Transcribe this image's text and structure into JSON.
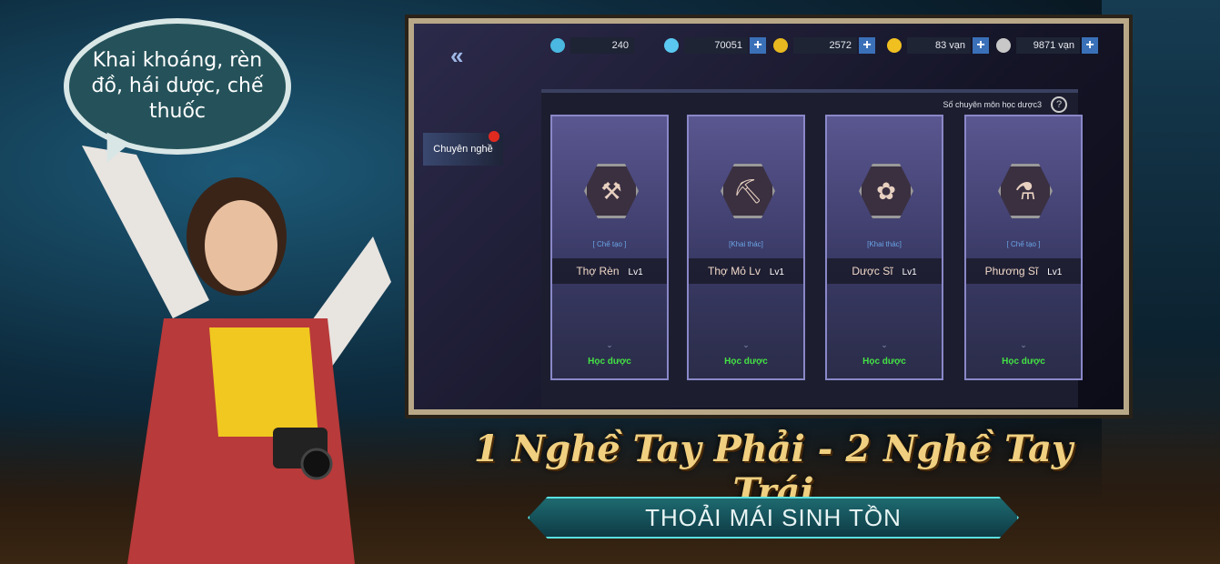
{
  "speech_bubble": "Khai khoáng, rèn đồ, hái dược, chế thuốc",
  "resources": [
    {
      "icon": "water-drop-icon",
      "value": "240",
      "color": "#4ab8e0",
      "plus": false
    },
    {
      "icon": "diamond-icon",
      "value": "70051",
      "color": "#5ac8f0",
      "plus": true
    },
    {
      "icon": "locked-gold-icon",
      "value": "2572",
      "color": "#e8b820",
      "plus": true
    },
    {
      "icon": "gold-coin-icon",
      "value": "83 vạn",
      "color": "#f0c020",
      "plus": true
    },
    {
      "icon": "silver-coin-icon",
      "value": "9871 vạn",
      "color": "#c8c8c8",
      "plus": true
    }
  ],
  "plus_label": "+",
  "back_label": "«",
  "side_tab": "Chuyên nghề",
  "count_label": "Số chuyên môn học dược3",
  "help_label": "?",
  "professions": [
    {
      "type": "[ Chế tạo ]",
      "name": "Thợ Rèn",
      "level": "Lv1",
      "icon": "hammer-icon",
      "glyph": "⚒",
      "action": "Học dược"
    },
    {
      "type": "[Khai thác]",
      "name": "Thợ Mỏ Lv",
      "level": "Lv1",
      "icon": "pickaxe-icon",
      "glyph": "⛏",
      "action": "Học dược"
    },
    {
      "type": "[Khai thác]",
      "name": "Dược Sĩ",
      "level": "Lv1",
      "icon": "herb-icon",
      "glyph": "✿",
      "action": "Học dược"
    },
    {
      "type": "[ Chế tạo ]",
      "name": "Phương Sĩ",
      "level": "Lv1",
      "icon": "potion-icon",
      "glyph": "⚗",
      "action": "Học dược"
    }
  ],
  "headline": "1 Nghề Tay Phải - 2 Nghề Tay Trái",
  "banner": "THOẢI MÁI SINH TỒN"
}
